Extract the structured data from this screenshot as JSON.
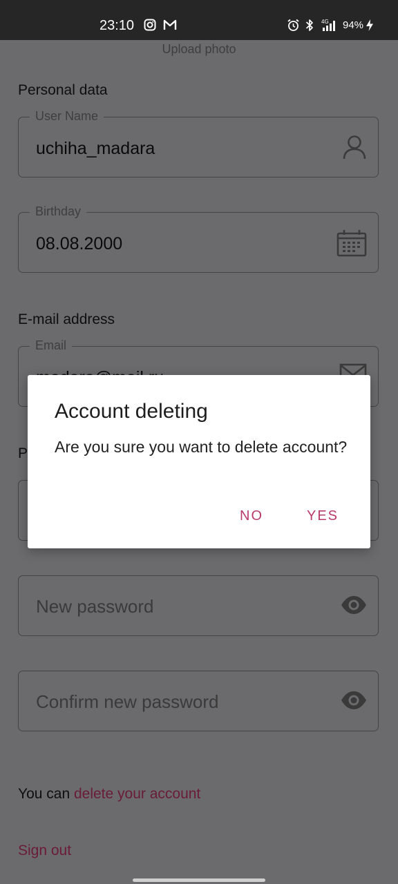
{
  "status_bar": {
    "time": "23:10",
    "network": "4G",
    "battery": "94%",
    "icons": [
      "instagram-icon",
      "gmail-icon",
      "alarm-icon",
      "bluetooth-icon",
      "signal-icon",
      "charging-icon"
    ]
  },
  "profile": {
    "upload_photo": "Upload photo",
    "personal_section": "Personal data",
    "user_name_label": "User Name",
    "user_name_value": "uchiha_madara",
    "birthday_label": "Birthday",
    "birthday_value": "08.08.2000",
    "email_section": "E-mail address",
    "email_label": "Email",
    "email_value": "madara@mail.ru",
    "password_section": "P",
    "new_password_placeholder": "New password",
    "confirm_password_placeholder": "Confirm new password",
    "delete_prefix": "You can ",
    "delete_link": "delete your account",
    "sign_out": "Sign out"
  },
  "dialog": {
    "title": "Account deleting",
    "message": "Are you sure you want to delete account?",
    "no_label": "NO",
    "yes_label": "YES"
  },
  "colors": {
    "accent": "#b83b6b",
    "link_dimmed": "#6a1b36",
    "scrim": "#6b6b6d"
  }
}
